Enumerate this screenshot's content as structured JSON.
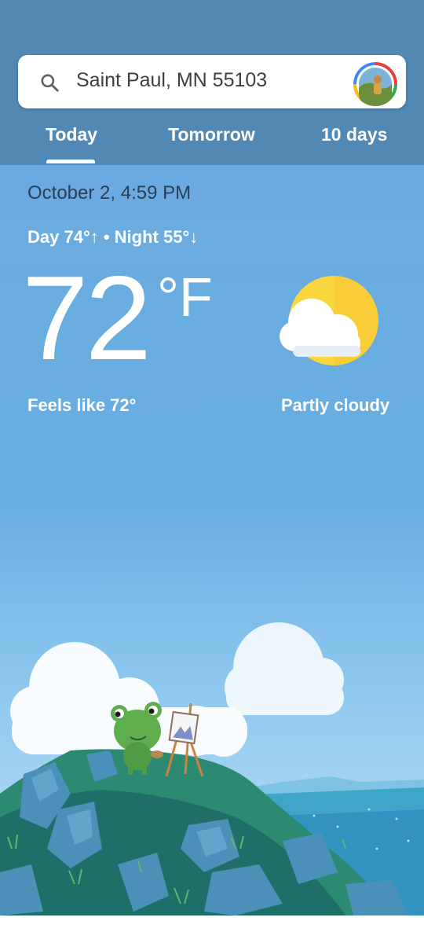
{
  "search": {
    "location": "Saint Paul, MN 55103",
    "search_icon": "search-icon",
    "avatar_icon": "account-avatar"
  },
  "tabs": [
    {
      "label": "Today",
      "selected": true
    },
    {
      "label": "Tomorrow",
      "selected": false
    },
    {
      "label": "10 days",
      "selected": false
    }
  ],
  "current": {
    "datetime": "October 2, 4:59 PM",
    "day_night": "Day 74°↑ • Night 55°↓",
    "temperature": "72",
    "unit": "°F",
    "feels_like": "Feels like 72°",
    "condition": "Partly cloudy",
    "condition_icon": "partly-cloudy-icon"
  },
  "colors": {
    "header_bg": "#5188b4",
    "sky_top": "#6aaae0",
    "sun": "#f9d53e"
  }
}
